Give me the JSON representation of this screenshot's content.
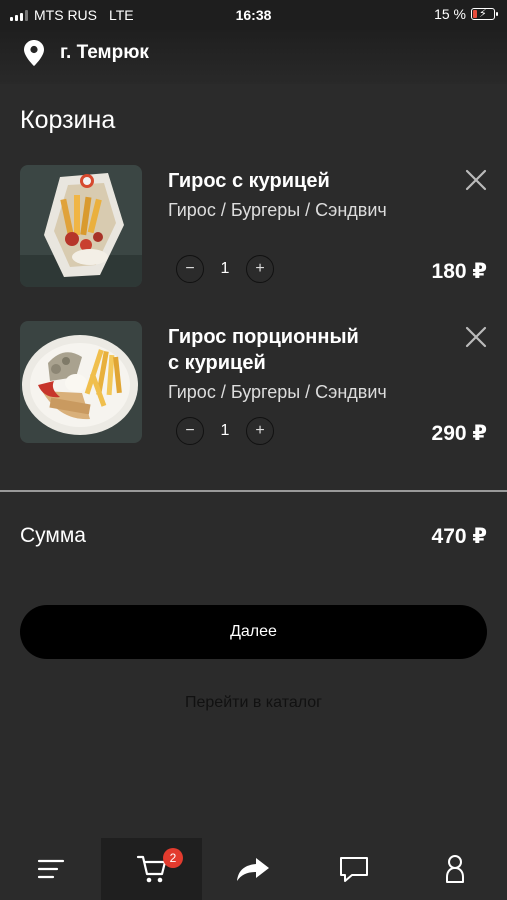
{
  "status_bar": {
    "carrier": "MTS RUS",
    "network": "LTE",
    "time": "16:38",
    "battery": "15 %"
  },
  "header": {
    "location": "г. Темрюк"
  },
  "page": {
    "title": "Корзина"
  },
  "cart": {
    "items": [
      {
        "name": "Гирос с курицей",
        "category": "Гирос / Бургеры / Сэндвич",
        "quantity": "1",
        "price": "180 ₽"
      },
      {
        "name": "Гирос порционный с курицей",
        "name_line1": "Гирос порционный",
        "name_line2": "с курицей",
        "category": "Гирос / Бургеры / Сэндвич",
        "quantity": "1",
        "price": "290 ₽"
      }
    ]
  },
  "summary": {
    "label": "Сумма",
    "value": "470 ₽"
  },
  "actions": {
    "next_label": "Далее",
    "catalog_link": "Перейти в каталог"
  },
  "tabbar": {
    "active": "cart",
    "cart_badge": "2",
    "tabs": [
      {
        "id": "menu",
        "icon": "menu-icon"
      },
      {
        "id": "cart",
        "icon": "cart-icon"
      },
      {
        "id": "share",
        "icon": "share-icon"
      },
      {
        "id": "chat",
        "icon": "chat-icon"
      },
      {
        "id": "profile",
        "icon": "profile-icon"
      }
    ]
  },
  "colors": {
    "background": "#2b2b2b",
    "badge": "#e23b2e",
    "button": "#000000"
  }
}
